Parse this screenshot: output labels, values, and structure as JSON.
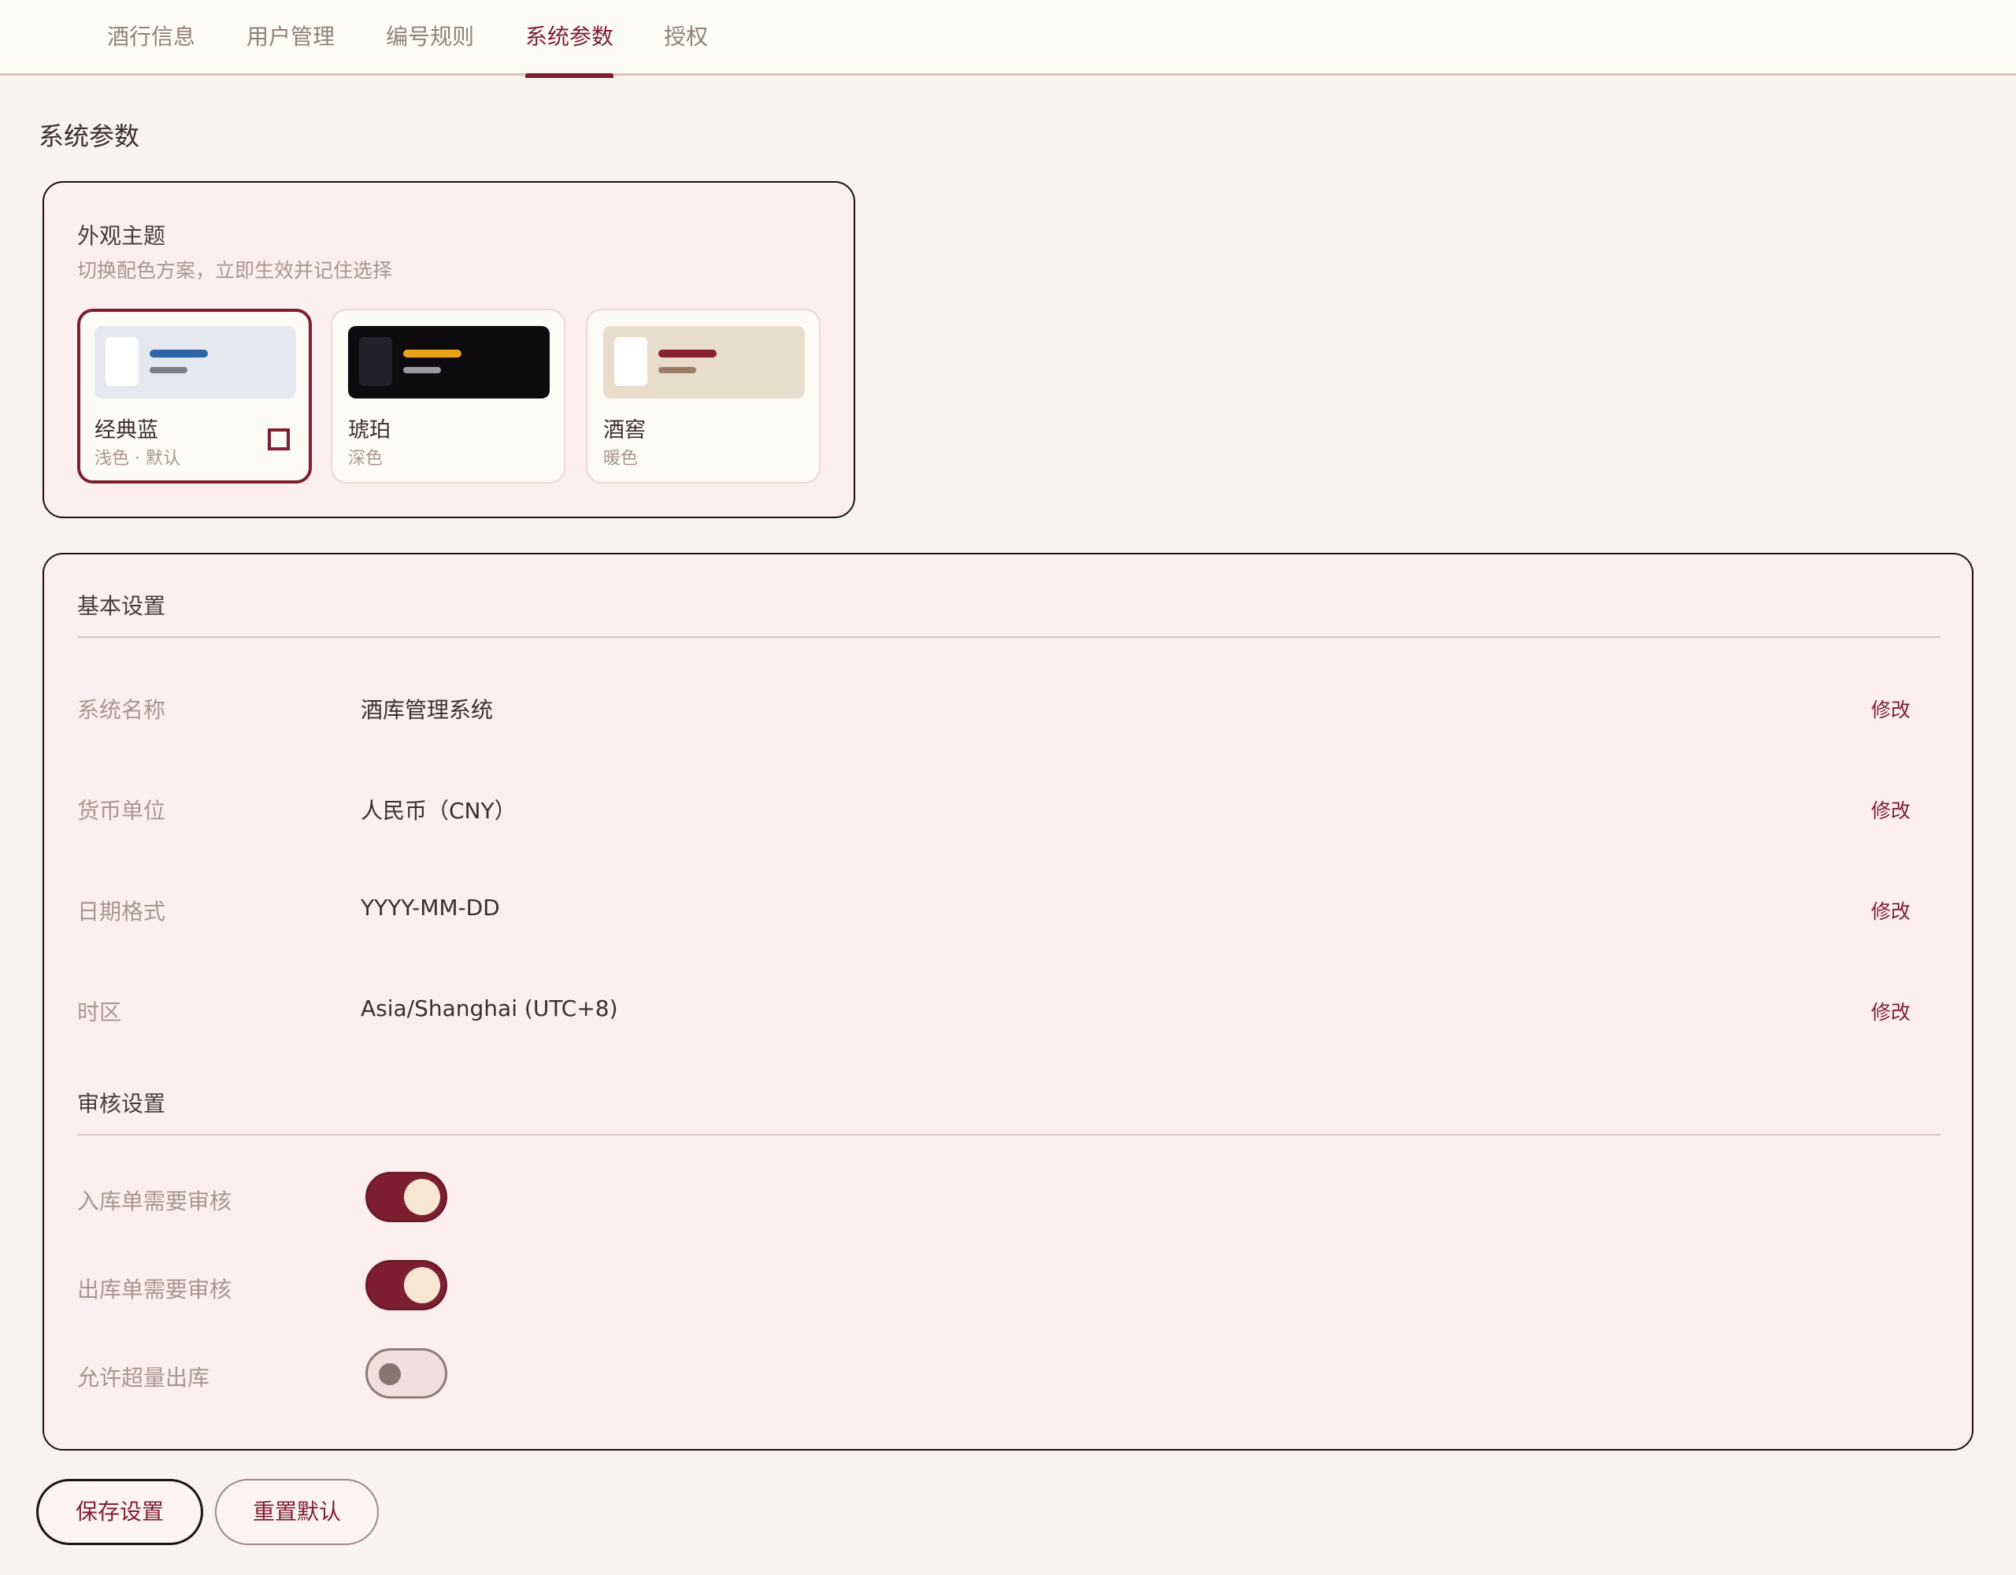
{
  "tabs": [
    {
      "label": "酒行信息",
      "active": false
    },
    {
      "label": "用户管理",
      "active": false
    },
    {
      "label": "编号规则",
      "active": false
    },
    {
      "label": "系统参数",
      "active": true
    },
    {
      "label": "授权",
      "active": false
    }
  ],
  "page_title": "系统参数",
  "theme": {
    "title": "外观主题",
    "description": "切换配色方案，立即生效并记住选择",
    "options": [
      {
        "name": "经典蓝",
        "sub": "浅色 · 默认",
        "selected": true,
        "colors": {
          "bg": "#e6e8f0",
          "side": "#ffffff",
          "line1": "#2e64a8",
          "line2": "#7a7e88"
        }
      },
      {
        "name": "琥珀",
        "sub": "深色",
        "selected": false,
        "colors": {
          "bg": "#0e0b0f",
          "side": "#25212a",
          "line1": "#e8a319",
          "line2": "#9c98a0"
        }
      },
      {
        "name": "酒窖",
        "sub": "暖色",
        "selected": false,
        "colors": {
          "bg": "#e8dcca",
          "side": "#ffffff",
          "line1": "#8a1f30",
          "line2": "#9c7e68"
        }
      }
    ]
  },
  "basic": {
    "title": "基本设置",
    "edit_label": "修改",
    "rows": [
      {
        "label": "系统名称",
        "value": "酒库管理系统"
      },
      {
        "label": "货币单位",
        "value": "人民币（CNY）"
      },
      {
        "label": "日期格式",
        "value": "YYYY-MM-DD"
      },
      {
        "label": "时区",
        "value": "Asia/Shanghai (UTC+8)"
      }
    ]
  },
  "audit": {
    "title": "审核设置",
    "toggles": [
      {
        "label": "入库单需要审核",
        "on": true
      },
      {
        "label": "出库单需要审核",
        "on": true
      },
      {
        "label": "允许超量出库",
        "on": false
      }
    ]
  },
  "buttons": {
    "save": "保存设置",
    "reset": "重置默认"
  },
  "colors": {
    "accent": "#7d1f31",
    "background": "#f8f3ee",
    "card_bg": "#fdeff0"
  }
}
